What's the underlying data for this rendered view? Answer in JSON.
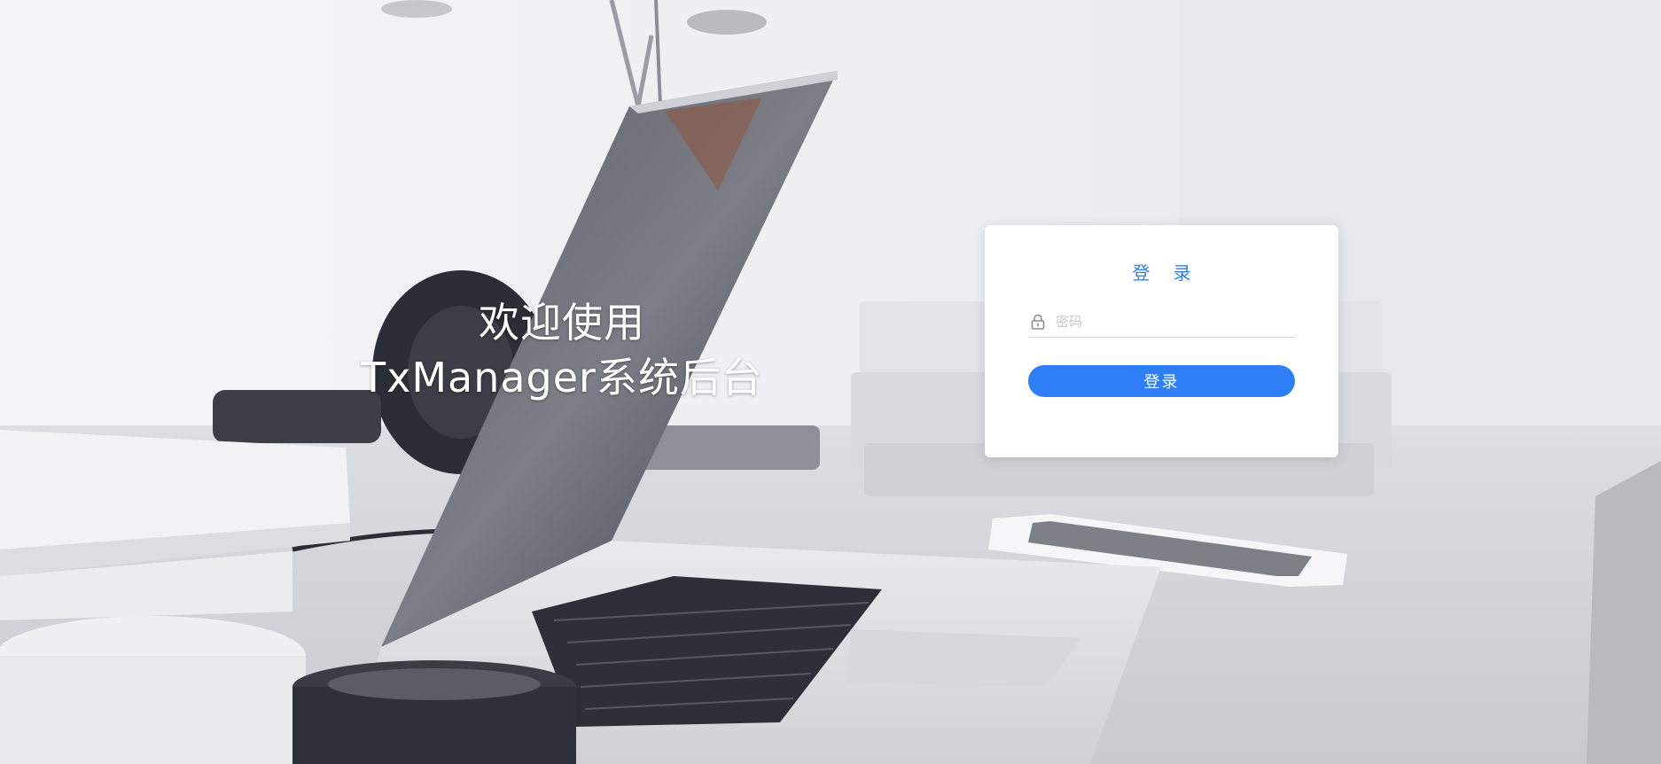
{
  "welcome": {
    "line1": "欢迎使用",
    "line2": "TxManager系统后台"
  },
  "login": {
    "title": "登 录",
    "password_placeholder": "密码",
    "password_value": "",
    "submit_label": "登录",
    "lock_icon": "lock-icon"
  },
  "colors": {
    "accent": "#2d7ef7",
    "card_bg": "#ffffff"
  }
}
